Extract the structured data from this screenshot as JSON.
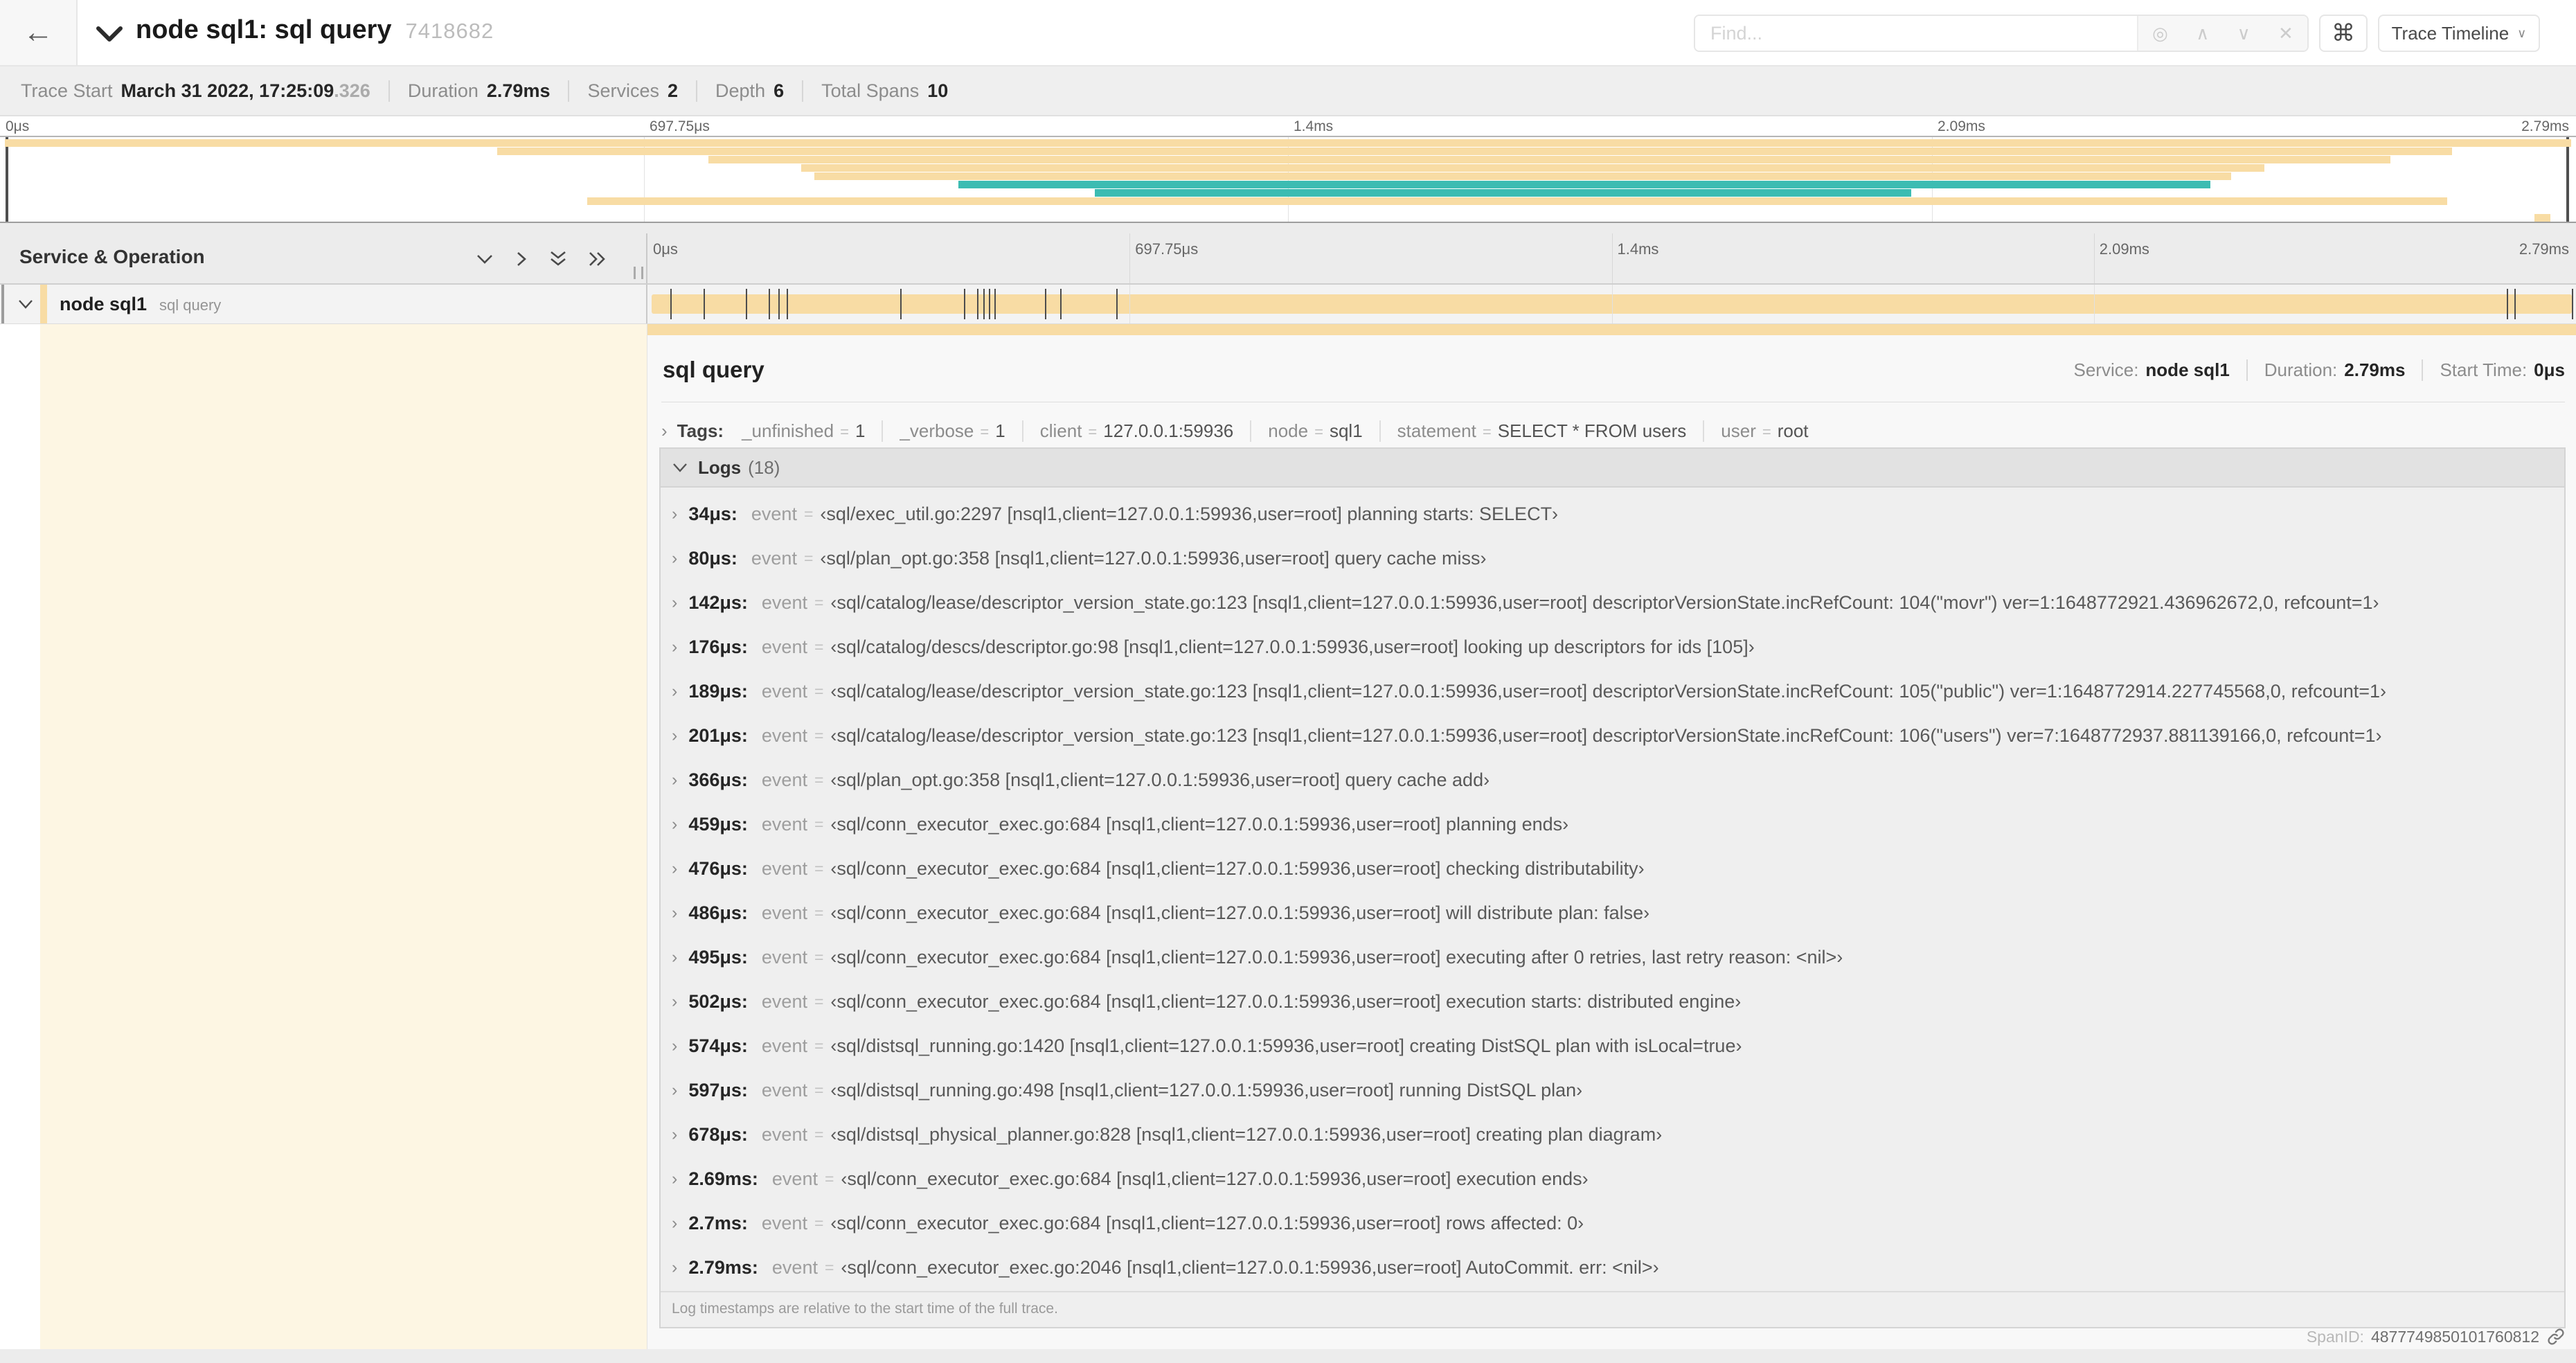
{
  "colors": {
    "tan": "#f8dca4",
    "teal": "#3cbcb2",
    "cream": "#fdf6e3"
  },
  "icons": {
    "back": "←",
    "chevron_right": "›",
    "caret_down": "∨",
    "locate": "◎",
    "prev": "∧",
    "next": "∨",
    "close": "✕",
    "command": "⌘"
  },
  "topbar": {
    "title": "node sql1: sql query",
    "trace_id": "7418682",
    "find_placeholder": "Find...",
    "view_select": "Trace Timeline"
  },
  "summary": {
    "items": [
      {
        "label": "Trace Start",
        "value": "March 31 2022, 17:25:09",
        "suffix": ".326"
      },
      {
        "label": "Duration",
        "value": "2.79ms"
      },
      {
        "label": "Services",
        "value": "2"
      },
      {
        "label": "Depth",
        "value": "6"
      },
      {
        "label": "Total Spans",
        "value": "10"
      }
    ]
  },
  "timeline": {
    "header_label": "Service & Operation",
    "ticks": [
      {
        "label": "0μs",
        "pos": 0
      },
      {
        "label": "697.75μs",
        "pos": 0.25
      },
      {
        "label": "1.4ms",
        "pos": 0.5
      },
      {
        "label": "2.09ms",
        "pos": 0.75
      },
      {
        "label": "2.79ms",
        "pos": 1
      }
    ],
    "gridlines": [
      0.25,
      0.5,
      0.75
    ]
  },
  "minimap": {
    "spans": [
      {
        "row": 1,
        "start": 0.002,
        "end": 0.998,
        "color": "tan"
      },
      {
        "row": 2,
        "start": 0.193,
        "end": 0.952,
        "color": "tan"
      },
      {
        "row": 3,
        "start": 0.275,
        "end": 0.928,
        "color": "tan"
      },
      {
        "row": 4,
        "start": 0.311,
        "end": 0.879,
        "color": "tan"
      },
      {
        "row": 5,
        "start": 0.316,
        "end": 0.866,
        "color": "tan"
      },
      {
        "row": 6,
        "start": 0.372,
        "end": 0.858,
        "color": "teal"
      },
      {
        "row": 7,
        "start": 0.425,
        "end": 0.742,
        "color": "teal"
      },
      {
        "row": 8,
        "start": 0.228,
        "end": 0.95,
        "color": "tan"
      },
      {
        "row": 10,
        "start": 0.984,
        "end": 0.99,
        "color": "tan"
      }
    ]
  },
  "span_row": {
    "service": "node sql1",
    "operation": "sql query",
    "log_marks": [
      0.012,
      0.029,
      0.051,
      0.063,
      0.068,
      0.072,
      0.131,
      0.164,
      0.171,
      0.174,
      0.177,
      0.18,
      0.206,
      0.214,
      0.243,
      0.964,
      0.968,
      0.998
    ]
  },
  "detail": {
    "header": {
      "title": "sql query",
      "meta": [
        {
          "label": "Service:",
          "value": "node sql1"
        },
        {
          "label": "Duration:",
          "value": "2.79ms"
        },
        {
          "label": "Start Time:",
          "value": "0μs"
        }
      ]
    },
    "tags": {
      "label": "Tags:",
      "eq": "=",
      "items": [
        {
          "key": "_unfinished",
          "value": "1"
        },
        {
          "key": "_verbose",
          "value": "1"
        },
        {
          "key": "client",
          "value": "127.0.0.1:59936"
        },
        {
          "key": "node",
          "value": "sql1"
        },
        {
          "key": "statement",
          "value": "SELECT * FROM users"
        },
        {
          "key": "user",
          "value": "root"
        }
      ]
    },
    "logs": {
      "label": "Logs",
      "count": "(18)",
      "key": "event",
      "eq": "=",
      "footnote": "Log timestamps are relative to the start time of the full trace.",
      "rows": [
        {
          "ts": "34μs:",
          "value": "‹sql/exec_util.go:2297 [nsql1,client=127.0.0.1:59936,user=root] planning starts: SELECT›"
        },
        {
          "ts": "80μs:",
          "value": "‹sql/plan_opt.go:358 [nsql1,client=127.0.0.1:59936,user=root] query cache miss›"
        },
        {
          "ts": "142μs:",
          "value": "‹sql/catalog/lease/descriptor_version_state.go:123 [nsql1,client=127.0.0.1:59936,user=root] descriptorVersionState.incRefCount: 104(\"movr\") ver=1:1648772921.436962672,0, refcount=1›"
        },
        {
          "ts": "176μs:",
          "value": "‹sql/catalog/descs/descriptor.go:98 [nsql1,client=127.0.0.1:59936,user=root] looking up descriptors for ids [105]›"
        },
        {
          "ts": "189μs:",
          "value": "‹sql/catalog/lease/descriptor_version_state.go:123 [nsql1,client=127.0.0.1:59936,user=root] descriptorVersionState.incRefCount: 105(\"public\") ver=1:1648772914.227745568,0, refcount=1›"
        },
        {
          "ts": "201μs:",
          "value": "‹sql/catalog/lease/descriptor_version_state.go:123 [nsql1,client=127.0.0.1:59936,user=root] descriptorVersionState.incRefCount: 106(\"users\") ver=7:1648772937.881139166,0, refcount=1›"
        },
        {
          "ts": "366μs:",
          "value": "‹sql/plan_opt.go:358 [nsql1,client=127.0.0.1:59936,user=root] query cache add›"
        },
        {
          "ts": "459μs:",
          "value": "‹sql/conn_executor_exec.go:684 [nsql1,client=127.0.0.1:59936,user=root] planning ends›"
        },
        {
          "ts": "476μs:",
          "value": "‹sql/conn_executor_exec.go:684 [nsql1,client=127.0.0.1:59936,user=root] checking distributability›"
        },
        {
          "ts": "486μs:",
          "value": "‹sql/conn_executor_exec.go:684 [nsql1,client=127.0.0.1:59936,user=root] will distribute plan: false›"
        },
        {
          "ts": "495μs:",
          "value": "‹sql/conn_executor_exec.go:684 [nsql1,client=127.0.0.1:59936,user=root] executing after 0 retries, last retry reason: <nil>›"
        },
        {
          "ts": "502μs:",
          "value": "‹sql/conn_executor_exec.go:684 [nsql1,client=127.0.0.1:59936,user=root] execution starts: distributed engine›"
        },
        {
          "ts": "574μs:",
          "value": "‹sql/distsql_running.go:1420 [nsql1,client=127.0.0.1:59936,user=root] creating DistSQL plan with isLocal=true›"
        },
        {
          "ts": "597μs:",
          "value": "‹sql/distsql_running.go:498 [nsql1,client=127.0.0.1:59936,user=root] running DistSQL plan›"
        },
        {
          "ts": "678μs:",
          "value": "‹sql/distsql_physical_planner.go:828 [nsql1,client=127.0.0.1:59936,user=root] creating plan diagram›"
        },
        {
          "ts": "2.69ms:",
          "value": "‹sql/conn_executor_exec.go:684 [nsql1,client=127.0.0.1:59936,user=root] execution ends›"
        },
        {
          "ts": "2.7ms:",
          "value": "‹sql/conn_executor_exec.go:684 [nsql1,client=127.0.0.1:59936,user=root] rows affected: 0›"
        },
        {
          "ts": "2.79ms:",
          "value": "‹sql/conn_executor_exec.go:2046 [nsql1,client=127.0.0.1:59936,user=root] AutoCommit. err: <nil>›"
        }
      ]
    },
    "footer": {
      "label": "SpanID:",
      "value": "4877749850101760812"
    }
  }
}
